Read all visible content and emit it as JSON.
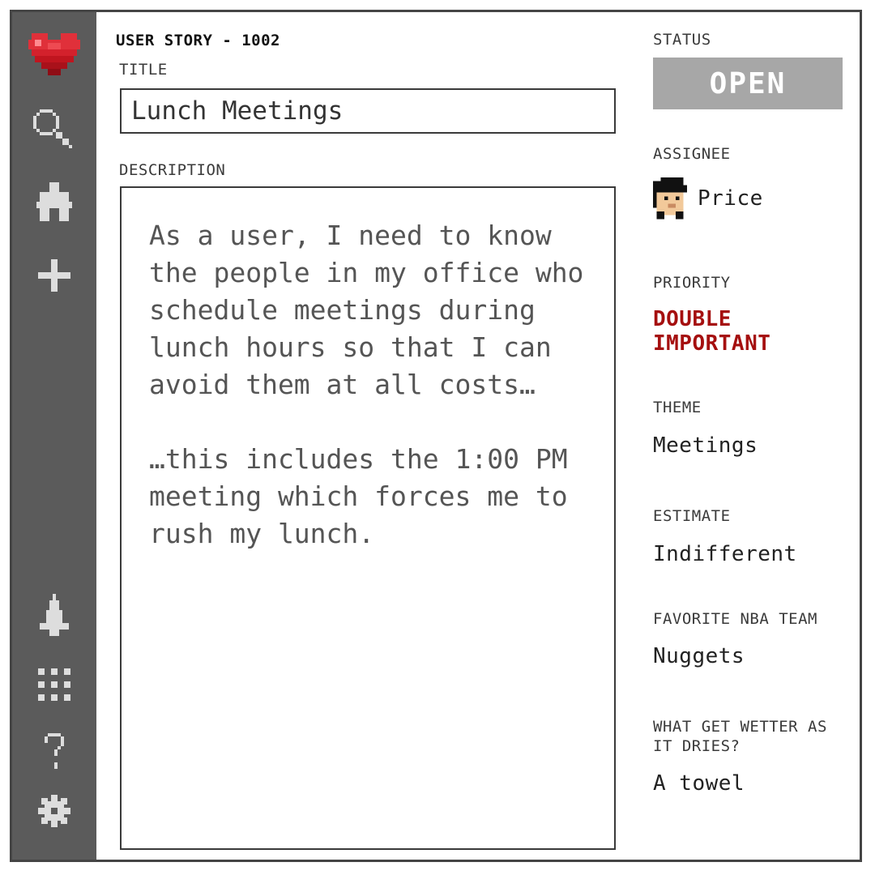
{
  "story": {
    "id_label": "USER STORY - 1002",
    "title_label": "TITLE",
    "title_value": "Lunch Meetings",
    "description_label": "DESCRIPTION",
    "description_p1": "As a user, I need to know the people in my office who schedule meetings during lunch hours so that I can avoid them at all costs…",
    "description_p2": "…this includes the 1:00 PM meeting which forces me to rush my lunch."
  },
  "fields": {
    "status_label": "STATUS",
    "status_value": "OPEN",
    "assignee_label": "ASSIGNEE",
    "assignee_value": "Price",
    "priority_label": "PRIORITY",
    "priority_line1": "DOUBLE",
    "priority_line2": "IMPORTANT",
    "theme_label": "THEME",
    "theme_value": "Meetings",
    "estimate_label": "ESTIMATE",
    "estimate_value": "Indifferent",
    "nba_label": "FAVORITE NBA TEAM",
    "nba_value": "Nuggets",
    "riddle_label": "WHAT GET WETTER AS IT DRIES?",
    "riddle_value": "A towel"
  },
  "sidebar": {
    "icons": [
      "heart-icon",
      "search-icon",
      "puzzle-icon",
      "plus-icon",
      "bell-icon",
      "grid-icon",
      "help-icon",
      "gear-icon"
    ]
  },
  "colors": {
    "sidebar": "#5b5b5b",
    "status_bg": "#a7a7a7",
    "priority": "#a50f0f",
    "heart": "#e0303a"
  }
}
